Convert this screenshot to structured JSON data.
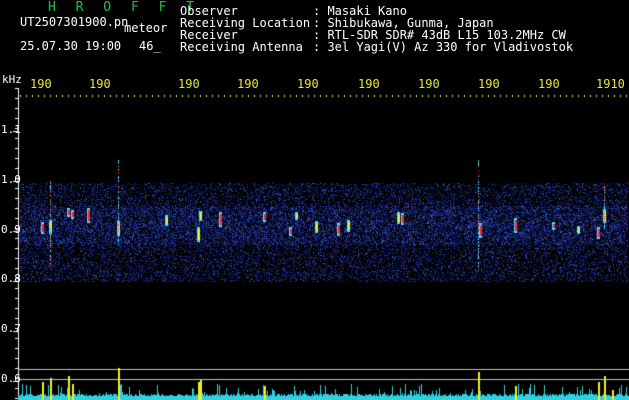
{
  "header": {
    "logo": "H R O F F T",
    "filename": "UT2507301900.pn",
    "mode": "meteor",
    "timestamp": "25.07.30 19:00",
    "count": "46_"
  },
  "info": [
    {
      "label": "Observer",
      "value": ": Masaki Kano"
    },
    {
      "label": "Receiving Location",
      "value": ": Shibukawa, Gunma, Japan"
    },
    {
      "label": "Receiver",
      "value": ": RTL-SDR SDR# 43dB L15 103.2MHz CW"
    },
    {
      "label": "Receiving Antenna",
      "value": ": 3el Yagi(V) Az 330 for Vladivostok"
    }
  ],
  "spectrogram": {
    "y_unit": "kHz",
    "y_ticks": [
      "1.1",
      "1.0",
      "0.9",
      "0.8",
      "0.7",
      "0.6"
    ],
    "x_ticks": [
      "190",
      "190",
      "190",
      "190",
      "190",
      "190",
      "190",
      "190",
      "190",
      "1910"
    ],
    "colors": {
      "background": "#000000",
      "noise_dark": "#101a60",
      "noise_light": "#3050c0",
      "echo_red": "#ff2020",
      "echo_yellow": "#f0f020",
      "echo_cyan": "#40e0ff",
      "amplitude": "#f0f020",
      "amplitude_base": "#30d0e0"
    }
  }
}
